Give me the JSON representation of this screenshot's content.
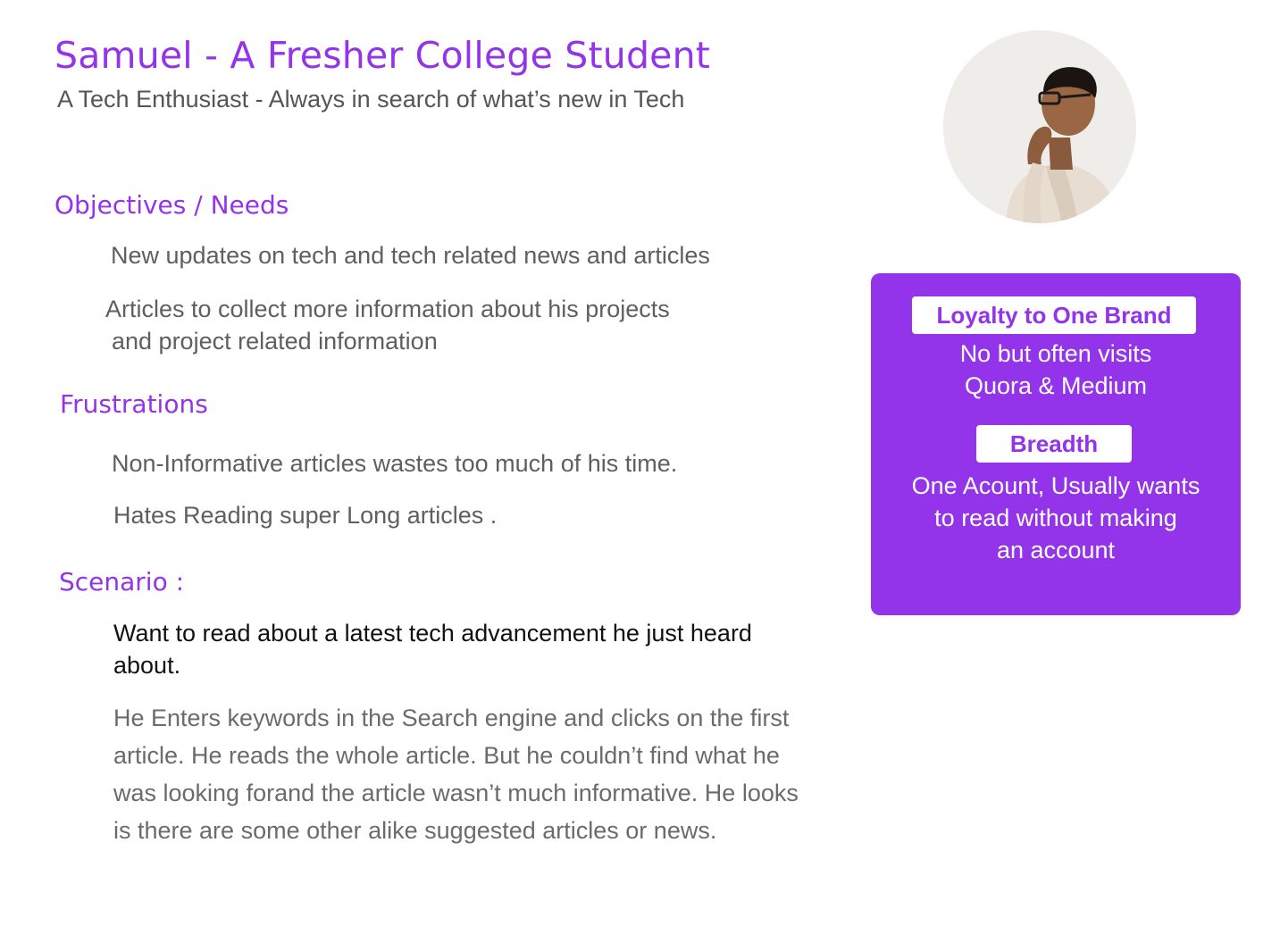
{
  "header": {
    "title": "Samuel - A Fresher College Student",
    "subtitle": "A Tech Enthusiast - Always in search of  what’s new in Tech"
  },
  "objectives": {
    "heading": "Objectives / Needs",
    "items": [
      "New updates  on tech and tech related news and articles",
      "Articles to collect more information about his projects",
      "and project related information"
    ]
  },
  "frustrations": {
    "heading": "Frustrations",
    "items": [
      "Non-Informative articles wastes too much of his time.",
      "Hates Reading super Long articles ."
    ]
  },
  "scenario": {
    "heading": "Scenario :",
    "title": "Want to read about a latest tech advancement he just heard about.",
    "body": "He Enters keywords in the Search engine and clicks on the first article. He reads the whole article. But he couldn’t find what he was looking forand the article wasn’t much informative. He looks is there are some other alike suggested articles or news."
  },
  "card": {
    "loyalty_label": "Loyalty to One Brand",
    "loyalty_line1": "No but often visits",
    "loyalty_line2": "Quora & Medium",
    "breadth_label": "Breadth",
    "breadth_line1": "One Acount, Usually wants",
    "breadth_line2": "to read without making",
    "breadth_line3": "an account"
  },
  "colors": {
    "accent": "#9333ea",
    "text_gray": "#5f5f5f",
    "card_text": "#ffffff"
  }
}
